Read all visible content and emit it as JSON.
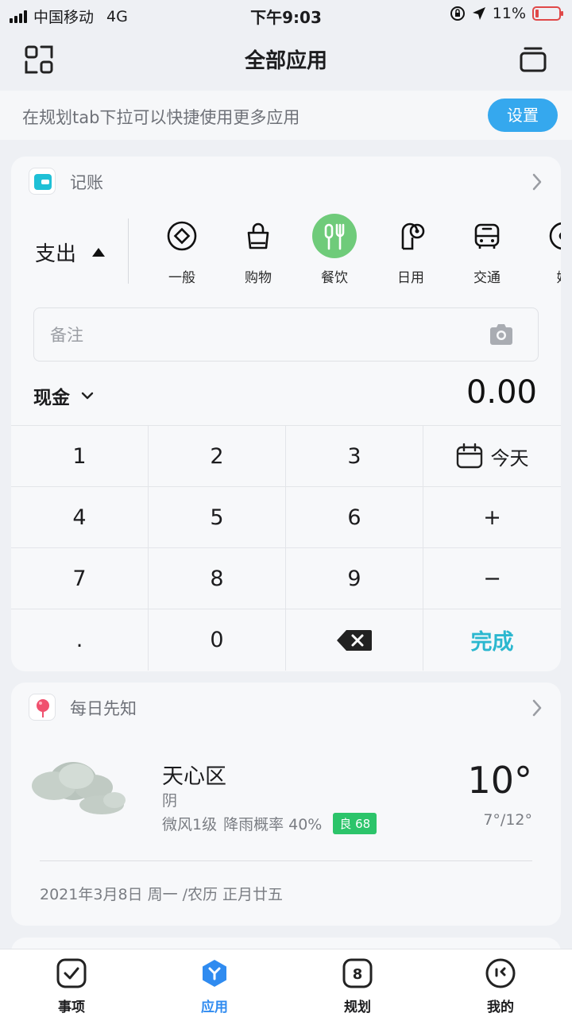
{
  "status_bar": {
    "carrier": "中国移动",
    "network": "4G",
    "time": "下午9:03",
    "battery": "11%"
  },
  "header": {
    "title": "全部应用"
  },
  "notice": {
    "text": "在规划tab下拉可以快捷使用更多应用",
    "button_label": "设置"
  },
  "ledger_card": {
    "title": "记账",
    "type_label": "支出",
    "categories": [
      {
        "name": "一般",
        "icon": "diamond-icon"
      },
      {
        "name": "购物",
        "icon": "shopping-bag-icon"
      },
      {
        "name": "餐饮",
        "icon": "dining-icon",
        "selected": true
      },
      {
        "name": "日用",
        "icon": "tissue-icon"
      },
      {
        "name": "交通",
        "icon": "bus-icon"
      },
      {
        "name": "娱",
        "icon": "entertainment-icon"
      }
    ],
    "memo_placeholder": "备注",
    "account": "现金",
    "amount": "0.00",
    "keys": [
      "1",
      "2",
      "3",
      "今天",
      "4",
      "5",
      "6",
      "+",
      "7",
      "8",
      "9",
      "−",
      ".",
      "0",
      "⌫",
      "完成"
    ]
  },
  "weather_card": {
    "title": "每日先知",
    "city": "天心区",
    "condition": "阴",
    "wind": "微风1级",
    "rain": "降雨概率 40%",
    "aqi": "良 68",
    "temperature": "10°",
    "range": "7°/12°",
    "date": "2021年3月8日 周一 /农历 正月廿五"
  },
  "tabbar": {
    "items": [
      {
        "label": "事项",
        "icon": "checkbox-icon"
      },
      {
        "label": "应用",
        "icon": "apps-icon",
        "active": true
      },
      {
        "label": "规划",
        "icon": "calendar-8-icon"
      },
      {
        "label": "我的",
        "icon": "profile-icon"
      }
    ]
  },
  "colors": {
    "accent": "#35a8ee",
    "done": "#2bb7cf",
    "category_active": "#6fcb7a",
    "aqi": "#2cc46a",
    "tab_active": "#2f8bf0"
  }
}
